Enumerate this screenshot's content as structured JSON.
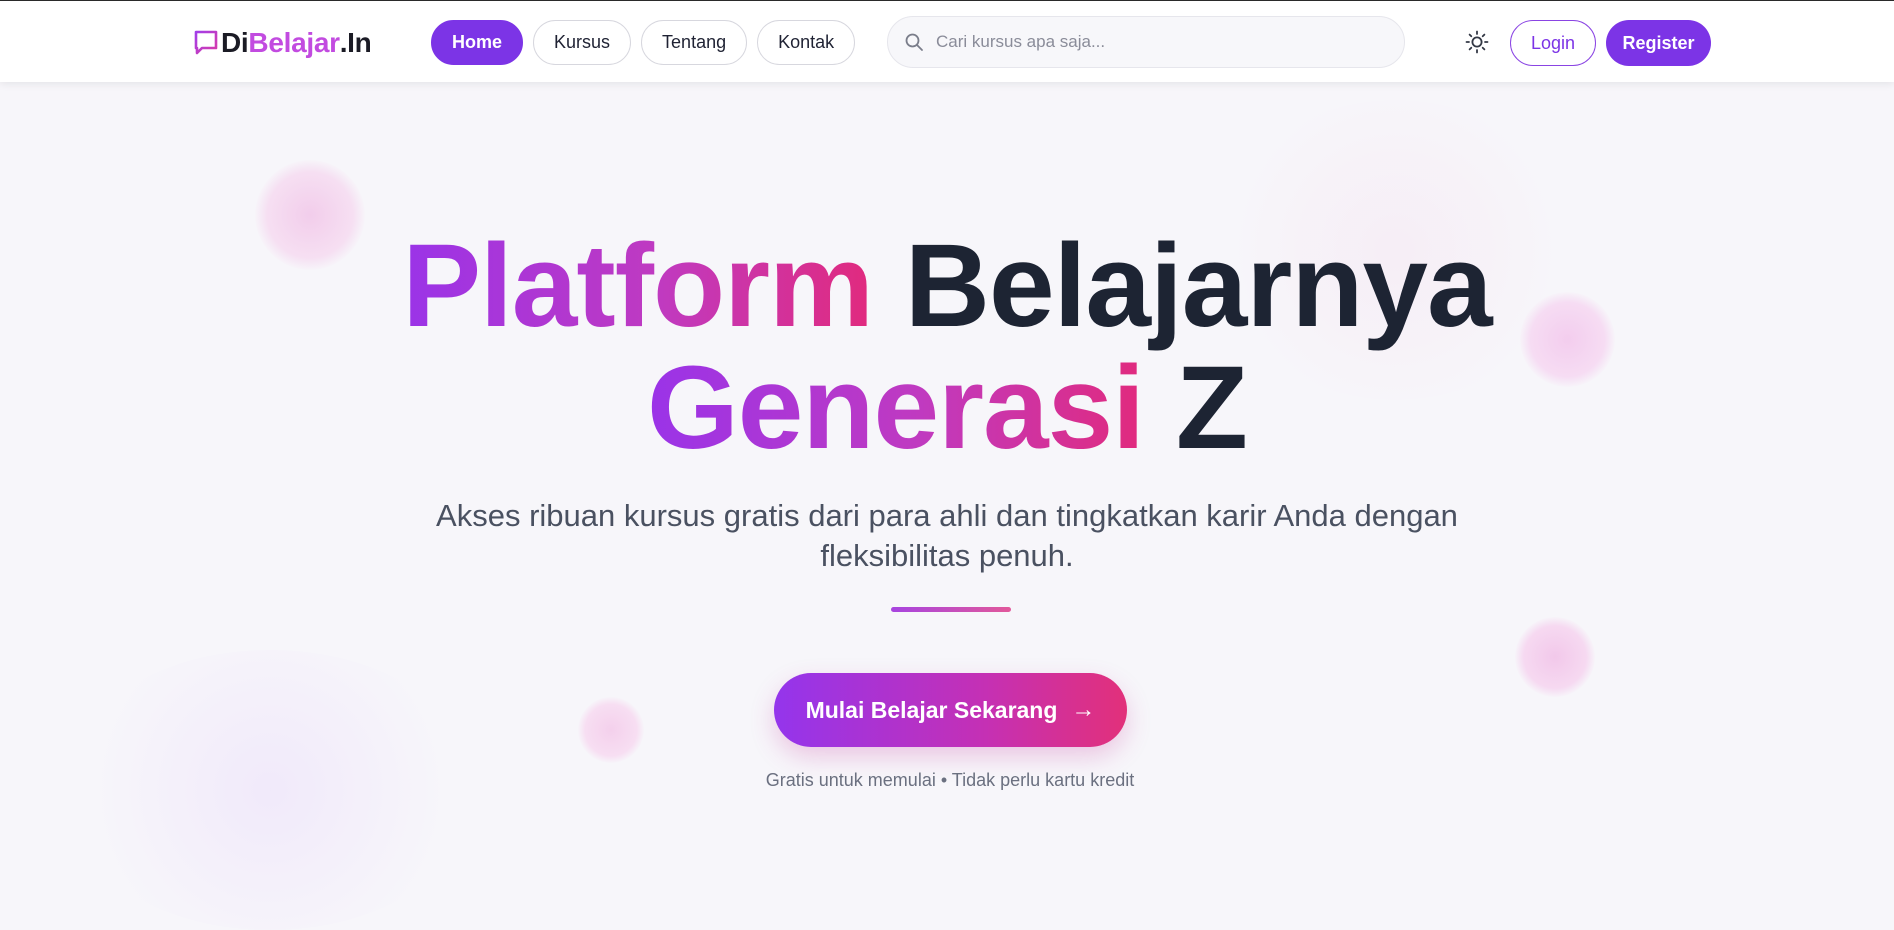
{
  "brand": {
    "logo_icon": "chat-bubble-icon",
    "name_part1": "Di",
    "name_part2": "Belajar",
    "name_part3": ".In"
  },
  "nav": {
    "items": [
      {
        "label": "Home",
        "active": true
      },
      {
        "label": "Kursus",
        "active": false
      },
      {
        "label": "Tentang",
        "active": false
      },
      {
        "label": "Kontak",
        "active": false
      }
    ]
  },
  "search": {
    "placeholder": "Cari kursus apa saja...",
    "value": "",
    "icon": "search-icon"
  },
  "header_actions": {
    "theme_icon": "sun-icon",
    "login_label": "Login",
    "register_label": "Register"
  },
  "hero": {
    "line1_gradient": "Platform",
    "line1_dark": "Belajarnya",
    "line2_gradient": "Generasi",
    "line2_dark": "Z",
    "subtitle": "Akses ribuan kursus gratis dari para ahli dan tingkatkan karir Anda dengan fleksibilitas penuh.",
    "cta_label": "Mulai Belajar Sekarang",
    "cta_arrow": "→",
    "note": "Gratis untuk memulai • Tidak perlu kartu kredit"
  },
  "colors": {
    "primary": "#7c34e6",
    "gradient_start": "#9a33e8",
    "gradient_end": "#e12a7d",
    "dark_text": "#1d2433"
  }
}
